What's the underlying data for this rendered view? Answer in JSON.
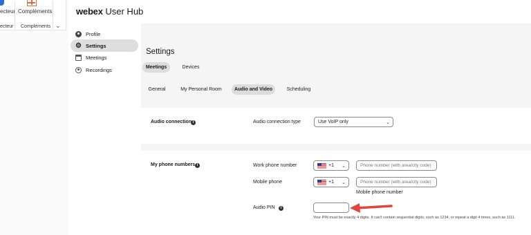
{
  "ribbon": {
    "lecteur_label": "ecteur",
    "lecteur_group": "ecteur",
    "complements_label": "Compléments",
    "complements_group": "Compléments"
  },
  "header": {
    "brand_bold": "webex",
    "brand_rest": "User Hub"
  },
  "sidebar": {
    "items": [
      {
        "label": "Profile",
        "icon": "profile-icon"
      },
      {
        "label": "Settings",
        "icon": "gear-icon"
      },
      {
        "label": "Meetings",
        "icon": "calendar-icon"
      },
      {
        "label": "Recordings",
        "icon": "recordings-icon"
      }
    ]
  },
  "page": {
    "title": "Settings",
    "tabs": [
      "Meetings",
      "Devices"
    ],
    "subtabs": [
      "General",
      "My Personal Room",
      "Audio and Video",
      "Scheduling"
    ]
  },
  "audio_connection": {
    "section": "Audio connection",
    "type_label": "Audio connection type",
    "type_value": "Use VoIP only"
  },
  "phone_numbers": {
    "section": "My phone numbers",
    "work_label": "Work phone number",
    "work_code": "+1",
    "work_placeholder": "Phone number (with area/city code)",
    "mobile_label": "Mobile phone",
    "mobile_code": "+1",
    "mobile_placeholder": "Phone number (with area/city code)",
    "mobile_caption": "Mobile phone number",
    "pin_label": "Audio PIN",
    "pin_help": "Your PIN must be exactly 4 digits. It can't contain sequential digits, such as 1234, or repeat a digit 4 times, such as 1111."
  },
  "colors": {
    "annotation_arrow": "#e0443a",
    "active_pill": "#dcdcdc"
  }
}
